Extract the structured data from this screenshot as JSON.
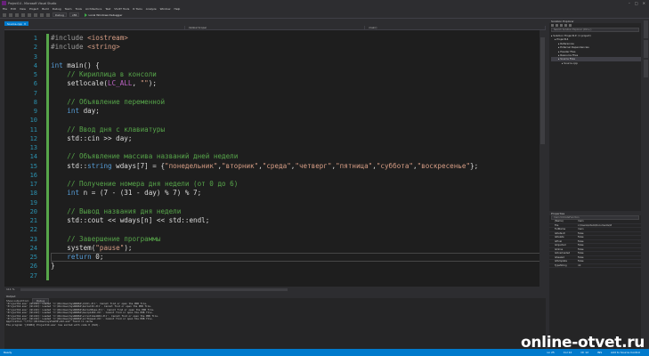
{
  "window": {
    "title": "Project14 - Microsoft Visual Studio"
  },
  "menu": [
    "File",
    "Edit",
    "View",
    "Project",
    "Build",
    "Debug",
    "Team",
    "Tools",
    "Architecture",
    "Test",
    "VS-RT Tools",
    "R Tools",
    "Analyze",
    "Window",
    "Help"
  ],
  "toolbar": {
    "config": "Debug",
    "platform": "x86",
    "run_label": "Local Windows Debugger"
  },
  "doc_tab": {
    "label": "Source.cpp"
  },
  "navbar": {
    "scope": "(Global Scope)",
    "member": "main()"
  },
  "code_lines": [
    {
      "n": "1",
      "parts": [
        [
          "pp",
          "#include "
        ],
        [
          "st",
          "<iostream>"
        ]
      ]
    },
    {
      "n": "2",
      "parts": [
        [
          "pp",
          "#include "
        ],
        [
          "st",
          "<string>"
        ]
      ]
    },
    {
      "n": "3",
      "parts": []
    },
    {
      "n": "4",
      "parts": [
        [
          "kw",
          "int"
        ],
        [
          "tx",
          " main() {"
        ]
      ]
    },
    {
      "n": "5",
      "parts": [
        [
          "tx",
          "    "
        ],
        [
          "cm",
          "// Кириллица в консоли"
        ]
      ]
    },
    {
      "n": "6",
      "parts": [
        [
          "tx",
          "    setlocale("
        ],
        [
          "mc",
          "LC_ALL"
        ],
        [
          "tx",
          ", "
        ],
        [
          "st",
          "\"\""
        ],
        [
          "tx",
          ");"
        ]
      ]
    },
    {
      "n": "7",
      "parts": []
    },
    {
      "n": "8",
      "parts": [
        [
          "tx",
          "    "
        ],
        [
          "cm",
          "// Объявление переменной"
        ]
      ]
    },
    {
      "n": "9",
      "parts": [
        [
          "tx",
          "    "
        ],
        [
          "kw",
          "int"
        ],
        [
          "tx",
          " day;"
        ]
      ]
    },
    {
      "n": "10",
      "parts": []
    },
    {
      "n": "11",
      "parts": [
        [
          "tx",
          "    "
        ],
        [
          "cm",
          "// Ввод дня с клавиатуры"
        ]
      ]
    },
    {
      "n": "12",
      "parts": [
        [
          "tx",
          "    std::cin >> day;"
        ]
      ]
    },
    {
      "n": "13",
      "parts": []
    },
    {
      "n": "14",
      "parts": [
        [
          "tx",
          "    "
        ],
        [
          "cm",
          "// Объявление массива названий дней недели"
        ]
      ]
    },
    {
      "n": "15",
      "parts": [
        [
          "tx",
          "    std::"
        ],
        [
          "kw",
          "string"
        ],
        [
          "tx",
          " wdays[7] = {"
        ],
        [
          "st",
          "\"понедельник\""
        ],
        [
          "tx",
          ","
        ],
        [
          "st",
          "\"вторник\""
        ],
        [
          "tx",
          ","
        ],
        [
          "st",
          "\"среда\""
        ],
        [
          "tx",
          ","
        ],
        [
          "st",
          "\"четверг\""
        ],
        [
          "tx",
          ","
        ],
        [
          "st",
          "\"пятница\""
        ],
        [
          "tx",
          ","
        ],
        [
          "st",
          "\"суббота\""
        ],
        [
          "tx",
          ","
        ],
        [
          "st",
          "\"воскресенье\""
        ],
        [
          "tx",
          "};"
        ]
      ]
    },
    {
      "n": "16",
      "parts": []
    },
    {
      "n": "17",
      "parts": [
        [
          "tx",
          "    "
        ],
        [
          "cm",
          "// Получение номера дня недели (от 0 до 6)"
        ]
      ]
    },
    {
      "n": "18",
      "parts": [
        [
          "tx",
          "    "
        ],
        [
          "kw",
          "int"
        ],
        [
          "tx",
          " n = (7 - (31 - day) % 7) % 7;"
        ]
      ]
    },
    {
      "n": "19",
      "parts": []
    },
    {
      "n": "20",
      "parts": [
        [
          "tx",
          "    "
        ],
        [
          "cm",
          "// Вывод названия дня недели"
        ]
      ]
    },
    {
      "n": "21",
      "parts": [
        [
          "tx",
          "    std::cout << wdays[n] << std::endl;"
        ]
      ]
    },
    {
      "n": "22",
      "parts": []
    },
    {
      "n": "23",
      "parts": [
        [
          "tx",
          "    "
        ],
        [
          "cm",
          "// Завершение программы"
        ]
      ]
    },
    {
      "n": "24",
      "parts": [
        [
          "tx",
          "    system("
        ],
        [
          "st",
          "\"pause\""
        ],
        [
          "tx",
          ");"
        ]
      ]
    },
    {
      "n": "25",
      "parts": [
        [
          "tx",
          "    "
        ],
        [
          "kw",
          "return"
        ],
        [
          "tx",
          " 0;"
        ]
      ]
    },
    {
      "n": "26",
      "parts": [
        [
          "tx",
          "}"
        ]
      ]
    },
    {
      "n": "27",
      "parts": []
    }
  ],
  "editor": {
    "zoom": "111 %"
  },
  "output": {
    "title": "Output",
    "source_label": "Show output from:",
    "source_value": "Debug",
    "lines": [
      "'Project14.exe' (Win32): Loaded 'C:\\Windows\\SysWOW64\\ntdll.dll'. Cannot find or open the PDB file.",
      "'Project14.exe' (Win32): Loaded 'C:\\Windows\\SysWOW64\\kernel32.dll'. Cannot find or open the PDB file.",
      "'Project14.exe' (Win32): Loaded 'C:\\Windows\\SysWOW64\\KernelBase.dll'. Cannot find or open the PDB file.",
      "'Project14.exe' (Win32): Loaded 'C:\\Windows\\SysWOW64\\msvcp140d.dll'. Cannot find or open the PDB file.",
      "'Project14.exe' (Win32): Loaded 'C:\\Windows\\SysWOW64\\vcruntime140d.dll'. Cannot find or open the PDB file.",
      "'Project14.exe' (Win32): Loaded 'C:\\Windows\\SysWOW64\\ucrtbased.dll'. Cannot find or open the PDB file.",
      "Application \"\\??\\C:\\Windows\\system32\\cmd.exe\" found in cache",
      "The program '[15984] Project14.exe' has exited with code 0 (0x0)."
    ]
  },
  "solution_explorer": {
    "title": "Solution Explorer",
    "search_placeholder": "Search Solution Explorer (Ctrl+;)",
    "nodes": [
      {
        "label": "Solution 'Project14' (1 project)",
        "depth": 0,
        "selected": false
      },
      {
        "label": "Project14",
        "depth": 1,
        "selected": false
      },
      {
        "label": "References",
        "depth": 2,
        "selected": false
      },
      {
        "label": "External Dependencies",
        "depth": 2,
        "selected": false
      },
      {
        "label": "Header Files",
        "depth": 2,
        "selected": false
      },
      {
        "label": "Resource Files",
        "depth": 2,
        "selected": false
      },
      {
        "label": "Source Files",
        "depth": 2,
        "selected": true
      },
      {
        "label": "Source.cpp",
        "depth": 3,
        "selected": false
      }
    ]
  },
  "properties": {
    "title": "Properties",
    "object": "main  VCCodeFunction",
    "rows": [
      {
        "k": "(Name)",
        "v": "main"
      },
      {
        "k": "File",
        "v": "c:\\Users\\Artem\\Documents\\Vi"
      },
      {
        "k": "FullName",
        "v": "main"
      },
      {
        "k": "IsDefault",
        "v": "False"
      },
      {
        "k": "IsDelete",
        "v": "False"
      },
      {
        "k": "IsFinal",
        "v": "False"
      },
      {
        "k": "IsInjected",
        "v": "False"
      },
      {
        "k": "IsInline",
        "v": "False"
      },
      {
        "k": "IsOverloaded",
        "v": "False"
      },
      {
        "k": "IsSealed",
        "v": "False"
      },
      {
        "k": "IsTemplate",
        "v": "False"
      },
      {
        "k": "TypeString",
        "v": "int"
      }
    ]
  },
  "status": {
    "left": "Ready",
    "ln": "Ln 25",
    "col": "Col 12",
    "ch": "Ch 12",
    "ins": "INS",
    "publish": "Add to Source Control"
  },
  "watermark": "online-otvet.ru"
}
